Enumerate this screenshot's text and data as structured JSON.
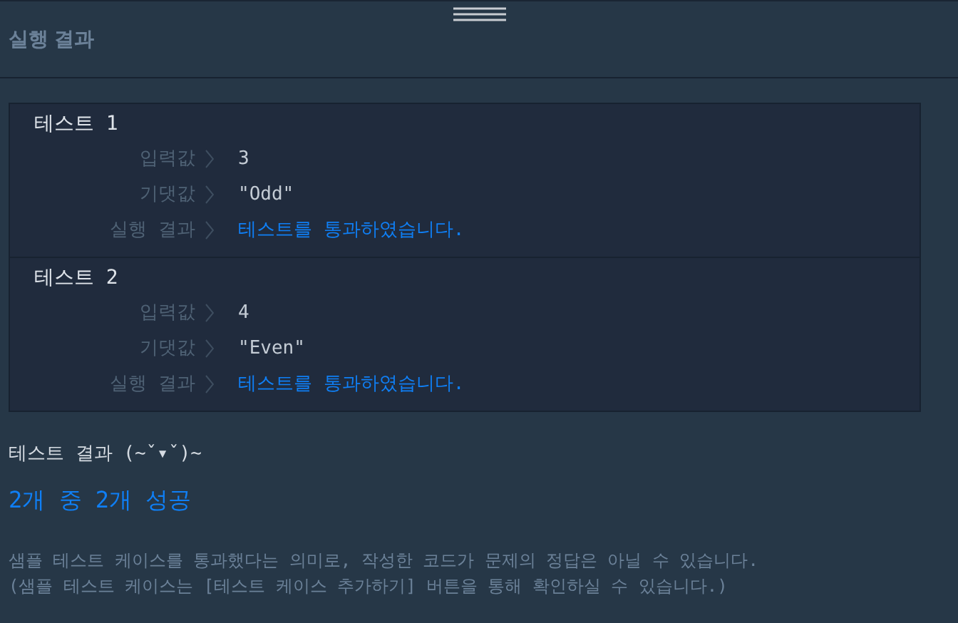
{
  "panel_title": "실행 결과",
  "tests": [
    {
      "title": "테스트 1",
      "rows": [
        {
          "kind": "value",
          "label": "입력값",
          "value": "3"
        },
        {
          "kind": "value",
          "label": "기댓값",
          "value": "\"Odd\""
        },
        {
          "kind": "result",
          "label": "실행 결과",
          "value": "테스트를 통과하였습니다."
        }
      ]
    },
    {
      "title": "테스트 2",
      "rows": [
        {
          "kind": "value",
          "label": "입력값",
          "value": "4"
        },
        {
          "kind": "value",
          "label": "기댓값",
          "value": "\"Even\""
        },
        {
          "kind": "result",
          "label": "실행 결과",
          "value": "테스트를 통과하였습니다."
        }
      ]
    }
  ],
  "summary": {
    "heading": "테스트 결과 (~ˇ▾ˇ)~",
    "score": "2개 중 2개 성공",
    "notes": [
      "샘플 테스트 케이스를 통과했다는 의미로, 작성한 코드가 문제의 정답은 아닐 수 있습니다.",
      "(샘플 테스트 케이스는 [테스트 케이스 추가하기] 버튼을 통해 확인하실 수 있습니다.)"
    ]
  }
}
